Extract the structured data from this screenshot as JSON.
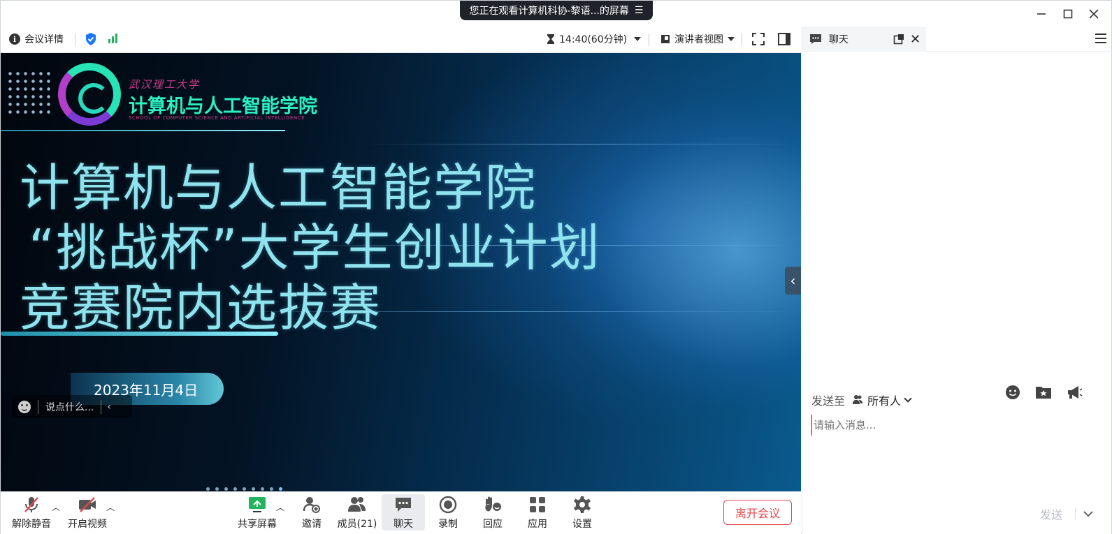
{
  "share_banner": {
    "text": "您正在观看计算机科协-黎语...的屏幕",
    "icon": "menu-icon"
  },
  "window_controls": [
    "minimize-icon",
    "maximize-icon",
    "close-icon"
  ],
  "toolbar": {
    "meeting_info_label": "会议详情",
    "timer": "14:40(60分钟)",
    "view_label": "演讲者视图",
    "colors": {
      "shield": "#1677ff",
      "signal": "#22b35e"
    }
  },
  "slide": {
    "school_script": "武汉理工大学",
    "school_name": "计算机与人工智能学院",
    "school_en": "SCHOOL OF COMPUTER SCIENCE AND ARTIFICIAL INTELLIGENCE",
    "title_line1": "计算机与人工智能学院",
    "title_line2": "“挑战杯”大学生创业计划",
    "title_line3": "竞赛院内选拔赛",
    "date": "2023年11月4日"
  },
  "comment": {
    "placeholder": "说点什么..."
  },
  "bottom_toolbar": {
    "unmute": "解除静音",
    "start_video": "开启视频",
    "share_screen": "共享屏幕",
    "invite": "邀请",
    "members": "成员(21)",
    "chat": "聊天",
    "record": "录制",
    "reaction": "回应",
    "apps": "应用",
    "settings": "设置",
    "leave": "离开会议",
    "colors": {
      "leave": "#e5484d",
      "share": "#22b35e",
      "muted": "#e5484d"
    }
  },
  "chat_panel": {
    "tab_label": "聊天",
    "send_to_label": "发送至",
    "send_to_target": "所有人",
    "input_placeholder": "请输入消息...",
    "send_label": "发送"
  }
}
